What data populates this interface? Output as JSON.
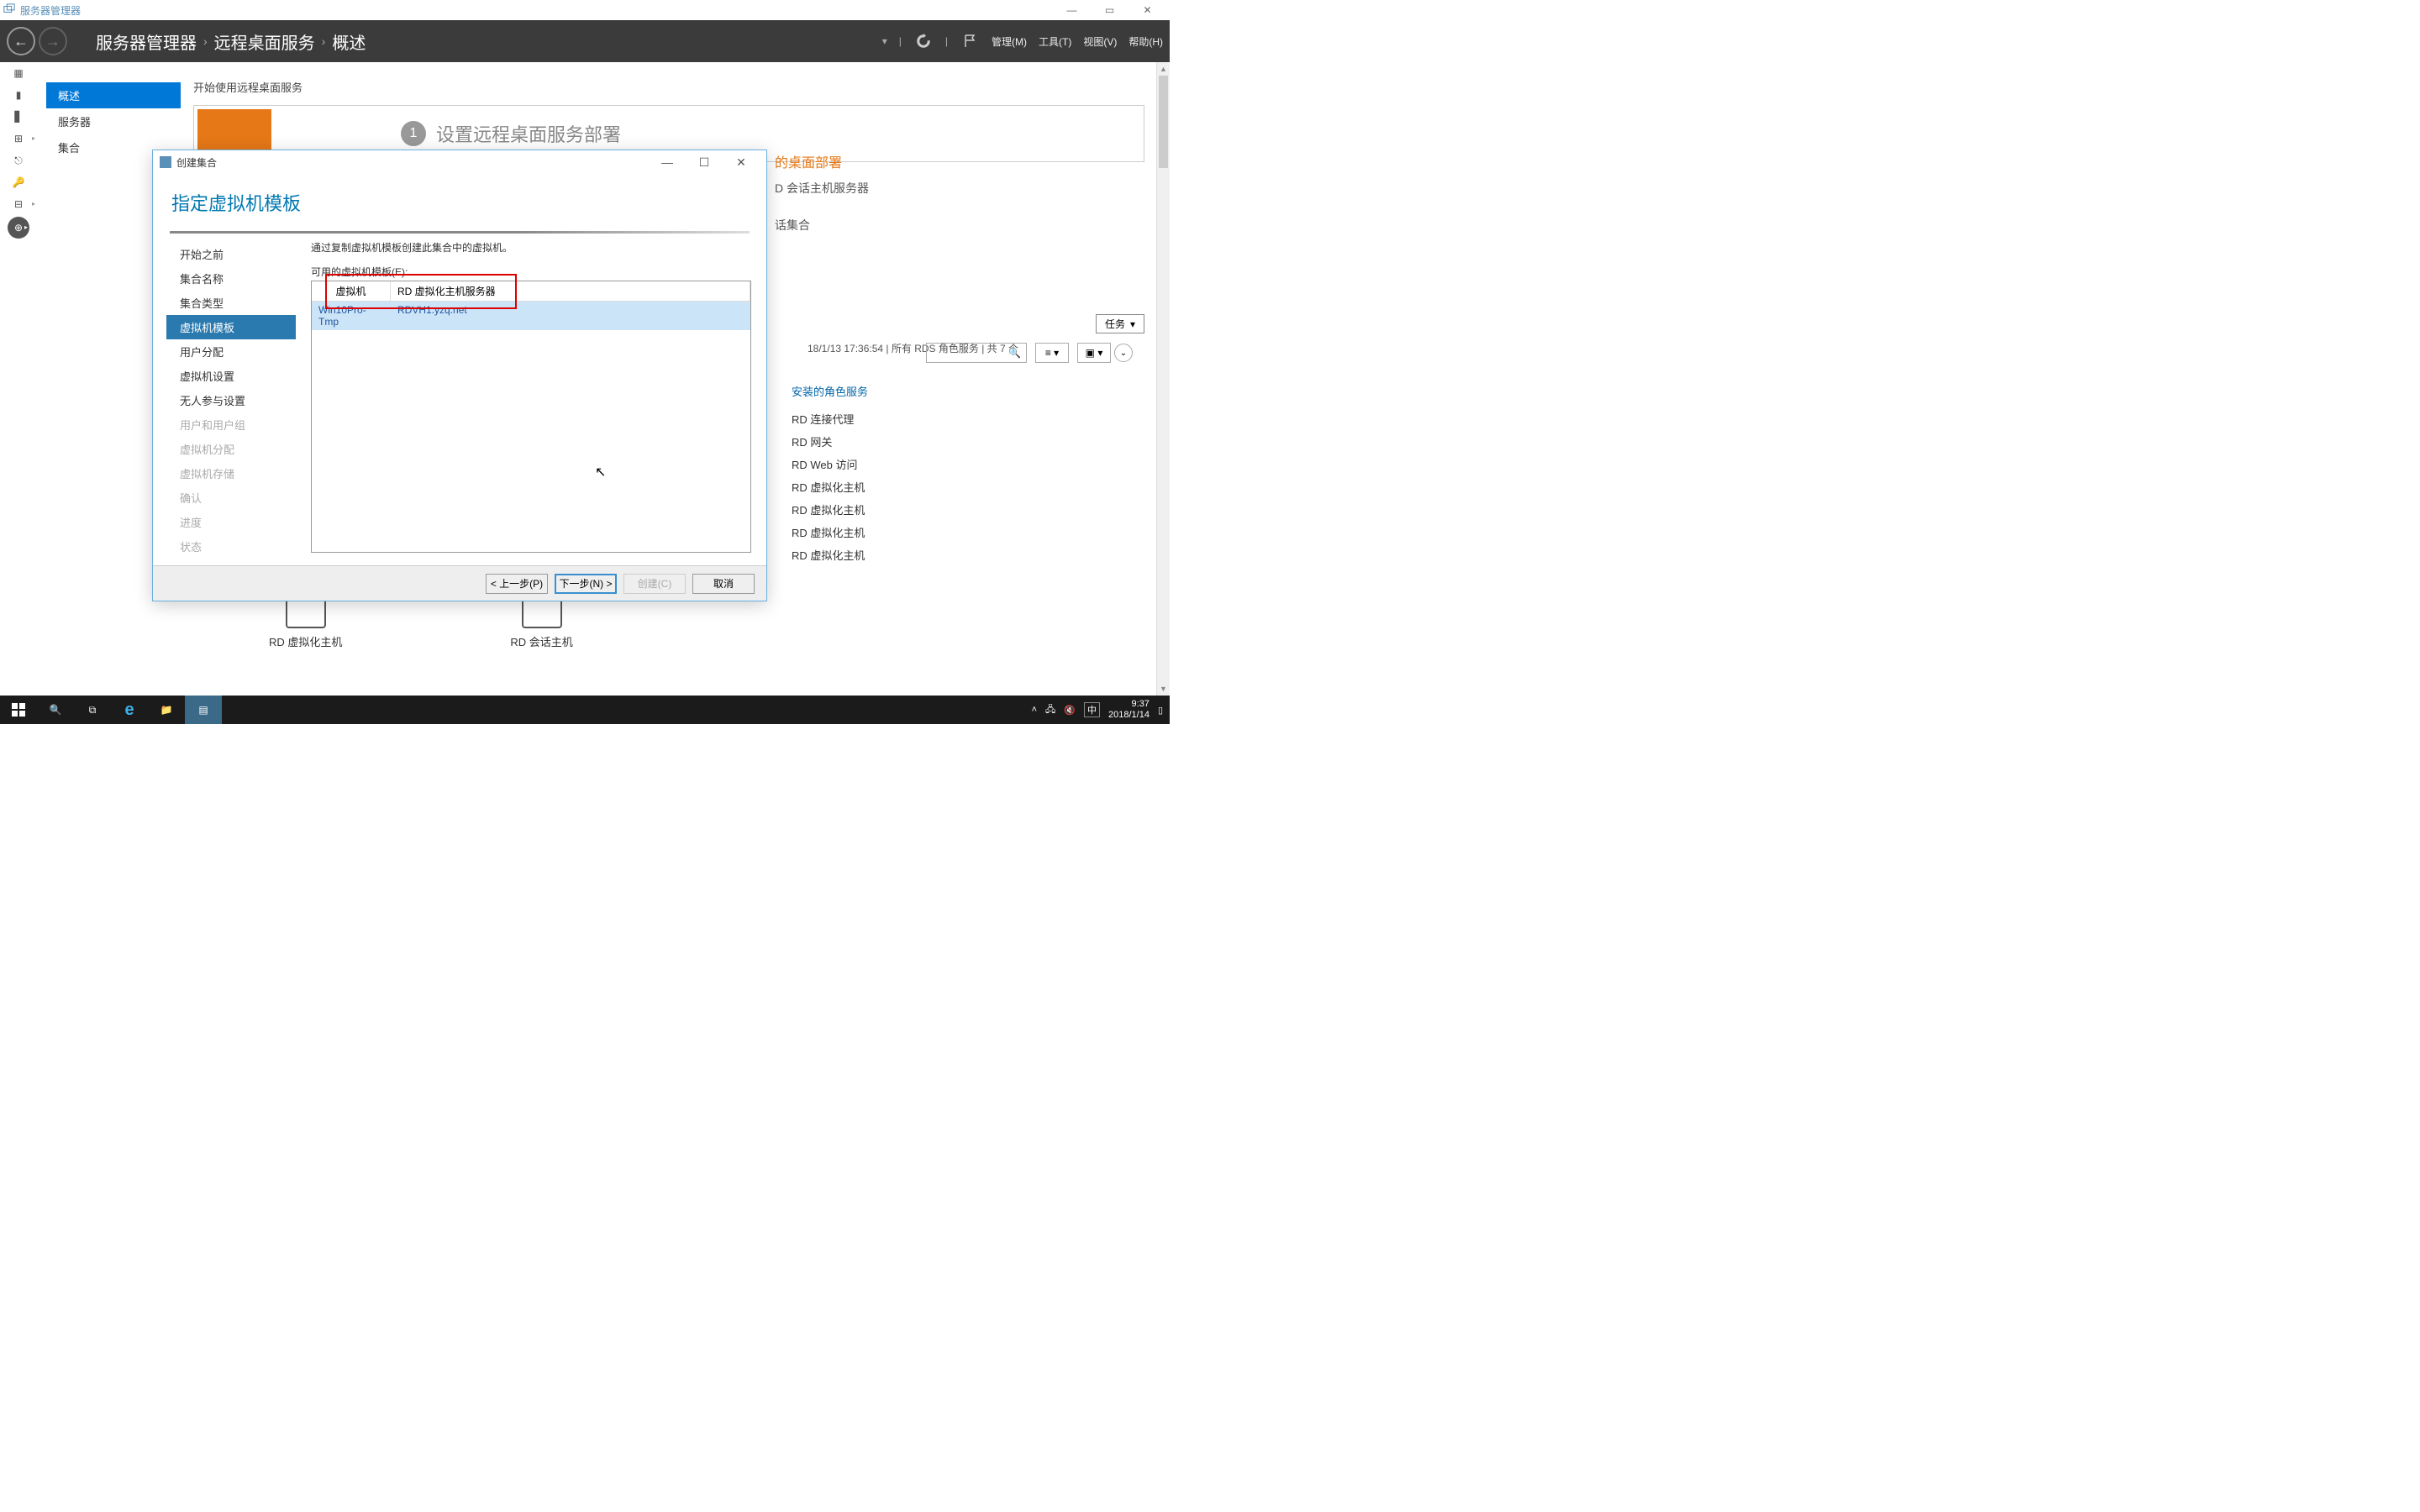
{
  "window_title": "服务器管理器",
  "breadcrumb": [
    "服务器管理器",
    "远程桌面服务",
    "概述"
  ],
  "header_menus": {
    "manage": "管理(M)",
    "tools": "工具(T)",
    "view": "视图(V)",
    "help": "帮助(H)"
  },
  "leftnav": {
    "items": [
      "概述",
      "服务器",
      "集合"
    ],
    "active": 0
  },
  "main": {
    "section_title": "开始使用远程桌面服务",
    "step_num": "1",
    "step_text": "设置远程桌面服务部署",
    "right_title_suffix": "的桌面部署",
    "right_line1_suffix": "D 会话主机服务器",
    "right_line2_suffix": "话集合",
    "status": "18/1/13 17:36:54 | 所有 RDS 角色服务  | 共 7 个",
    "task_label": "任务",
    "roles_header": "安装的角色服务",
    "roles": [
      "RD 连接代理",
      "RD 网关",
      "RD Web 访问",
      "RD 虚拟化主机",
      "RD 虚拟化主机",
      "RD 虚拟化主机",
      "RD 虚拟化主机"
    ],
    "bottom1": "RD 虚拟化主机",
    "bottom2": "RD 会话主机"
  },
  "dialog": {
    "title": "创建集合",
    "heading": "指定虚拟机模板",
    "nav": [
      {
        "label": "开始之前",
        "state": "normal"
      },
      {
        "label": "集合名称",
        "state": "normal"
      },
      {
        "label": "集合类型",
        "state": "normal"
      },
      {
        "label": "虚拟机模板",
        "state": "active"
      },
      {
        "label": "用户分配",
        "state": "normal"
      },
      {
        "label": "虚拟机设置",
        "state": "normal"
      },
      {
        "label": "无人参与设置",
        "state": "normal"
      },
      {
        "label": "用户和用户组",
        "state": "disabled"
      },
      {
        "label": "虚拟机分配",
        "state": "disabled"
      },
      {
        "label": "虚拟机存储",
        "state": "disabled"
      },
      {
        "label": "确认",
        "state": "disabled"
      },
      {
        "label": "进度",
        "state": "disabled"
      },
      {
        "label": "状态",
        "state": "disabled"
      }
    ],
    "desc": "通过复制虚拟机模板创建此集合中的虚拟机。",
    "table_label": "可用的虚拟机模板(E):",
    "th1": "虚拟机",
    "th2": "RD 虚拟化主机服务器",
    "row": {
      "vm": "Win10Pro-Tmp",
      "host": "RDVH1.yzq.net"
    },
    "buttons": {
      "prev": "< 上一步(P)",
      "next": "下一步(N) >",
      "create": "创建(C)",
      "cancel": "取消"
    }
  },
  "taskbar": {
    "ime": "中",
    "time": "9:37",
    "date": "2018/1/14"
  }
}
